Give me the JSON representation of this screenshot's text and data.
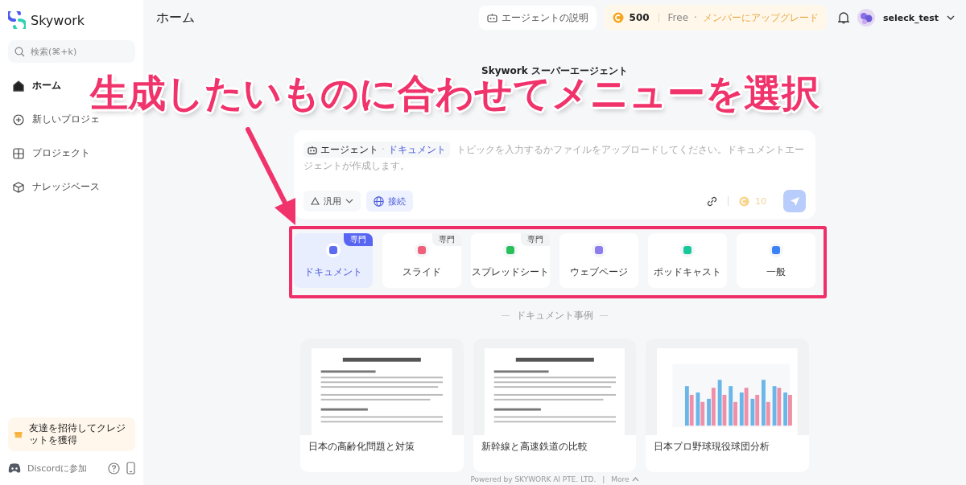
{
  "sidebar": {
    "logo": "Skywork",
    "search": {
      "placeholder": "検索(⌘+k)"
    },
    "items": [
      {
        "label": "ホーム",
        "selected": true
      },
      {
        "label": "新しいプロジェ",
        "selected": false
      },
      {
        "label": "プロジェクト",
        "selected": false
      },
      {
        "label": "ナレッジベース",
        "selected": false
      }
    ],
    "invite": "友達を招待してクレジットを獲得",
    "discord": "Discordに参加"
  },
  "header": {
    "title": "ホーム",
    "agent_help": "エージェントの説明",
    "credits": "500",
    "plan": "Free",
    "plan_separator": "·",
    "upgrade": "メンバーにアップグレード",
    "user": "seleck_test"
  },
  "hero": {
    "badge": "Skywork スーパーエージェント"
  },
  "composer": {
    "agent_label": "エージェント",
    "separator": "·",
    "agent_type": "ドキュメント",
    "placeholder": "トピックを入力するかファイルをアップロードしてください。ドキュメントエージェントが作成します。",
    "model": "汎用",
    "connect": "接続",
    "cost": "10"
  },
  "modes": [
    {
      "label": "ドキュメント",
      "badge": "専門",
      "color": "#5b6cf0",
      "selected": true
    },
    {
      "label": "スライド",
      "badge": "専門",
      "color": "#f0607a",
      "selected": false
    },
    {
      "label": "スプレッドシート",
      "badge": "専門",
      "color": "#28c05a",
      "selected": false
    },
    {
      "label": "ウェブページ",
      "color": "#8b7cf0",
      "selected": false
    },
    {
      "label": "ポッドキャスト",
      "color": "#17c99a",
      "selected": false
    },
    {
      "label": "一般",
      "color": "#3b82f6",
      "selected": false
    }
  ],
  "examples": {
    "heading": "ドキュメント事例",
    "items": [
      {
        "title": "日本の高齢化問題と対策",
        "kind": "picture"
      },
      {
        "title": "新幹線と高速鉄道の比較",
        "kind": "picture"
      },
      {
        "title": "日本プロ野球現役球団分析",
        "kind": "picture"
      }
    ]
  },
  "footer": {
    "powered": "Powered by SKYWORK AI PTE. LTD.",
    "separator": "|",
    "more": "More"
  },
  "annotation": {
    "caption": "生成したいものに合わせてメニューを選択"
  }
}
